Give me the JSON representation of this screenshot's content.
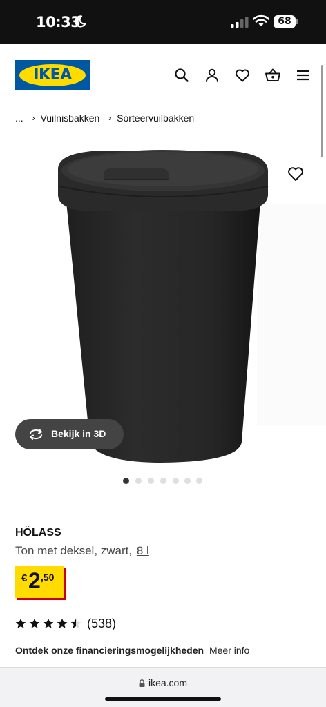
{
  "status_bar": {
    "time": "10:33",
    "battery": "68"
  },
  "header": {
    "logo_text": "IKEA",
    "icons": [
      "search-icon",
      "user-icon",
      "heart-icon",
      "basket-icon",
      "menu-icon"
    ]
  },
  "breadcrumb": {
    "ellipsis": "...",
    "items": [
      "Vuilnisbakken",
      "Sorteervuilbakken"
    ]
  },
  "gallery": {
    "view_3d_label": "Bekijk in 3D",
    "image_count": 7,
    "active_index": 0
  },
  "product": {
    "name": "HÖLASS",
    "description": "Ton met deksel, zwart,",
    "size": "8 l",
    "price": {
      "currency": "€",
      "integer": "2",
      "decimal": ",50"
    },
    "rating": {
      "stars": 4.5,
      "max": 5,
      "count": "(538)"
    },
    "financing_text": "Ontdek onze financieringsmogelijkheden",
    "financing_link": "Meer info"
  },
  "browser": {
    "url": "ikea.com"
  },
  "colors": {
    "brand_blue": "#0058a3",
    "brand_yellow": "#ffdb00",
    "price_shadow": "#cc0008"
  }
}
